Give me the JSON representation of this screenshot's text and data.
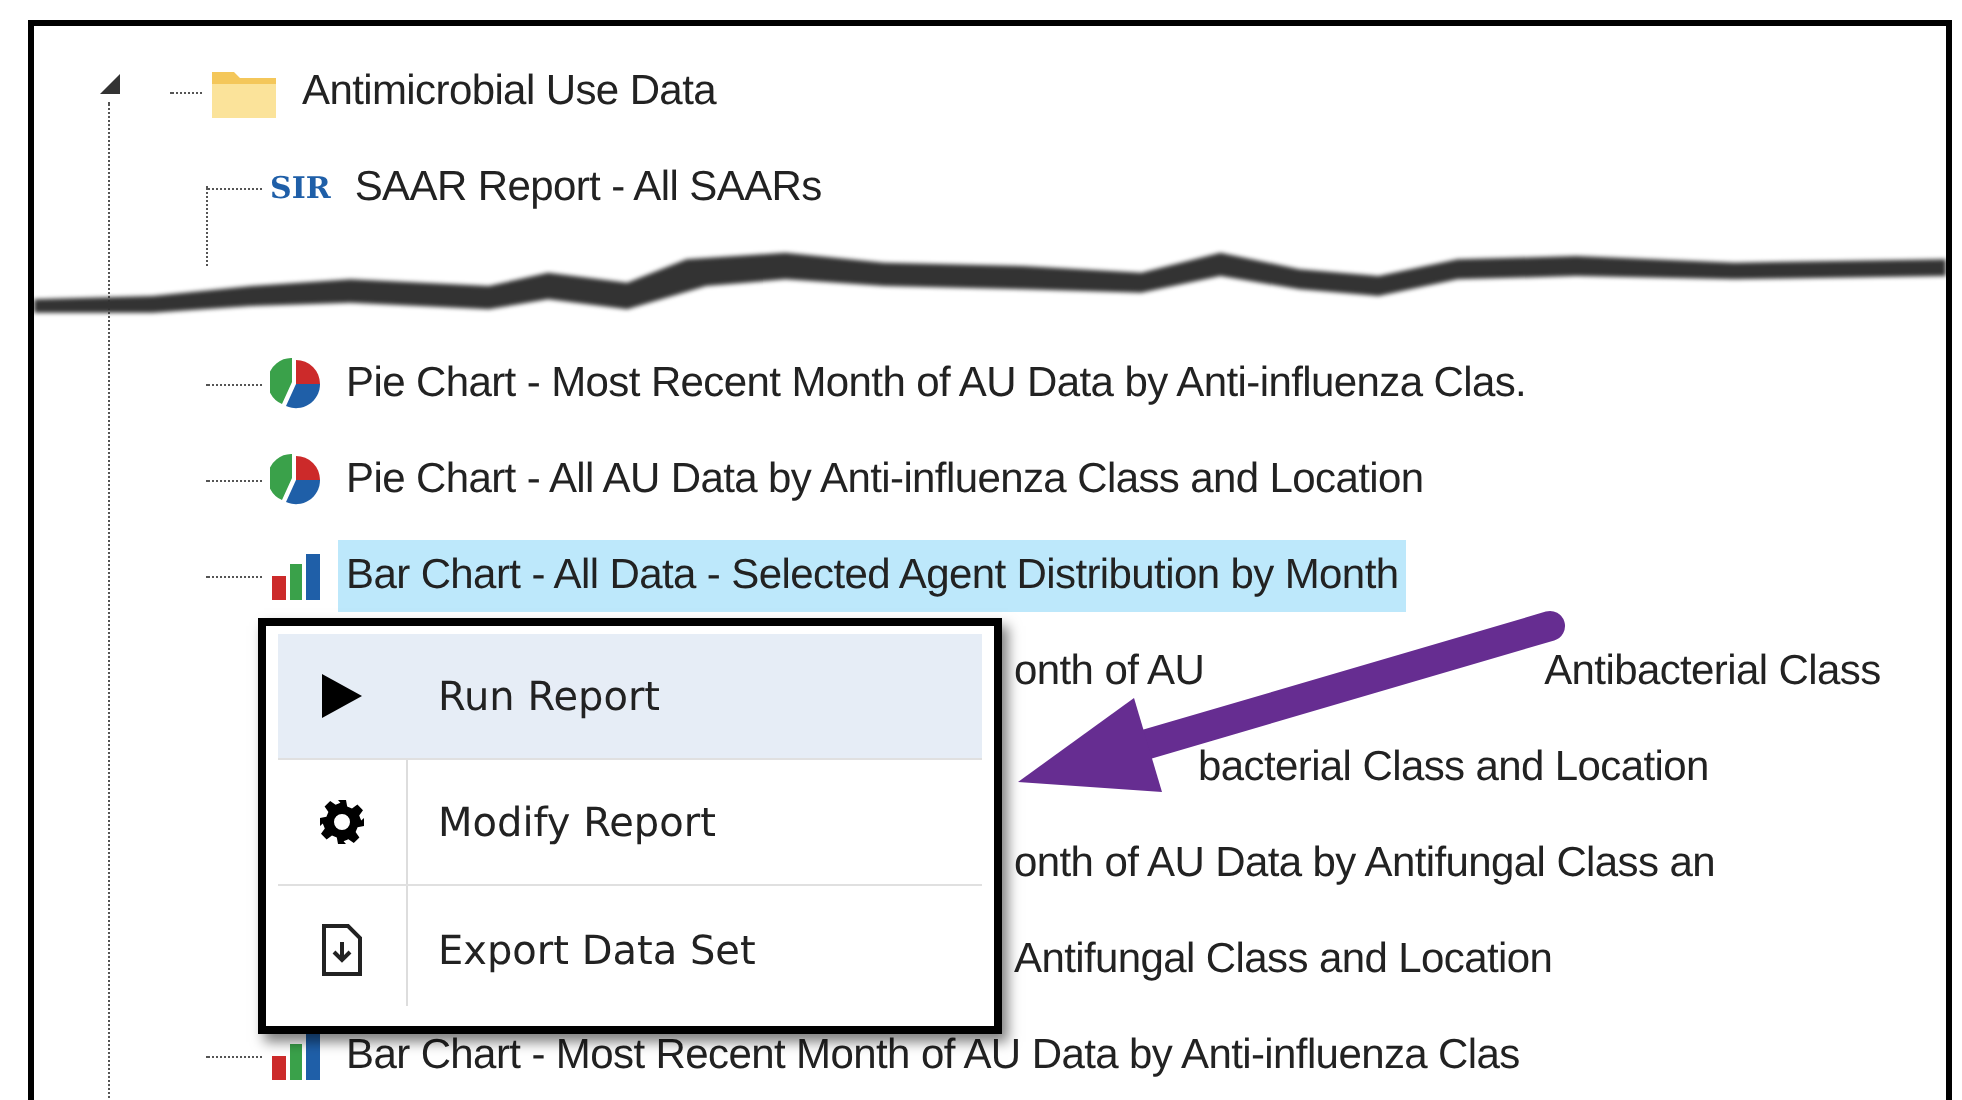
{
  "tree_top": [
    {
      "kind": "folder",
      "label": "Antimicrobial Use Data",
      "expanded": true
    },
    {
      "kind": "sir",
      "badge": "SIR",
      "label": "SAAR Report - All SAARs",
      "selected": false
    }
  ],
  "tree_bottom": [
    {
      "kind": "pie",
      "label": "Pie Chart - Most Recent Month of AU Data by Anti-influenza Clas.",
      "selected": false
    },
    {
      "kind": "pie",
      "label": "Pie Chart - All AU Data by Anti-influenza Class and Location",
      "selected": false
    },
    {
      "kind": "bar",
      "label": "Bar Chart - All Data - Selected Agent Distribution by Month",
      "selected": true
    },
    {
      "kind": "split",
      "parts": [
        "onth of AU",
        "Antibacterial Class"
      ],
      "selected": false
    },
    {
      "kind": "under_arrow",
      "label": "bacterial Class and Location",
      "selected": false
    },
    {
      "kind": "covered",
      "label": "onth of AU Data by Antifungal Class an",
      "selected": false
    },
    {
      "kind": "covered",
      "label": "Antifungal Class and Location",
      "selected": false
    },
    {
      "kind": "bar",
      "label": "Bar Chart - Most Recent Month of AU Data by Anti-influenza Clas",
      "selected": false
    }
  ],
  "context_menu": [
    {
      "kind": "run",
      "label": "Run Report",
      "selected": true
    },
    {
      "kind": "modify",
      "label": "Modify Report",
      "selected": false
    },
    {
      "kind": "export",
      "label": "Export Data Set",
      "selected": false
    }
  ]
}
